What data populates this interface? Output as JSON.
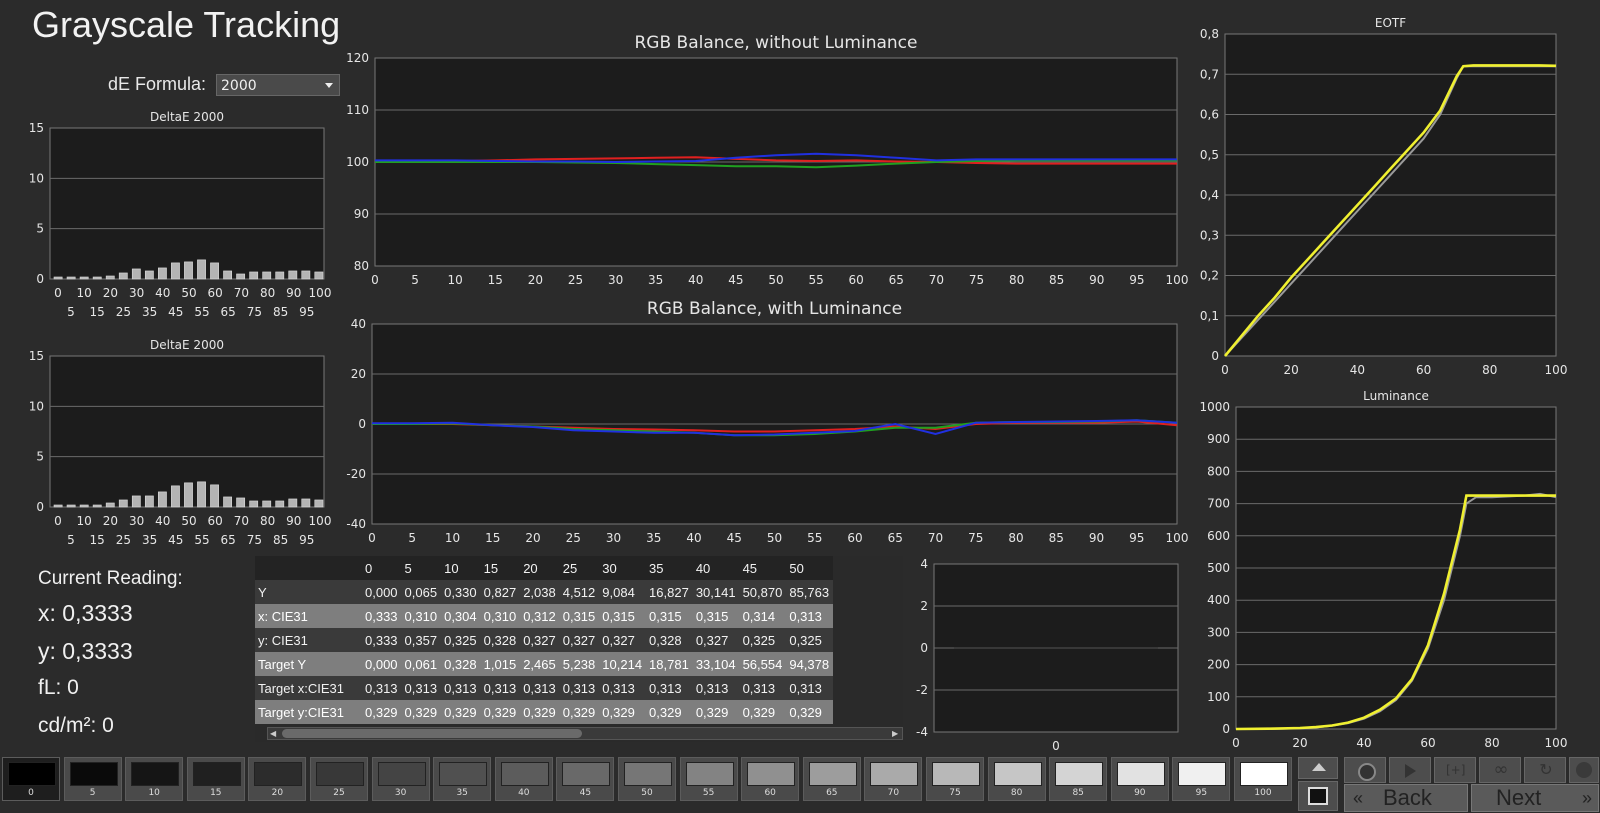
{
  "title": "Grayscale Tracking",
  "de_formula": {
    "label": "dE Formula:",
    "value": "2000"
  },
  "current_reading": {
    "heading": "Current Reading:",
    "x": "x: 0,3333",
    "y": "y: 0,3333",
    "fl": "fL: 0",
    "cdm2": "cd/m²: 0"
  },
  "chart_data": [
    {
      "id": "deltae1",
      "type": "bar",
      "title": "DeltaE 2000",
      "categories": [
        "0",
        "5",
        "10",
        "15",
        "20",
        "25",
        "30",
        "35",
        "40",
        "45",
        "50",
        "55",
        "60",
        "65",
        "70",
        "75",
        "80",
        "85",
        "90",
        "95",
        "100"
      ],
      "values": [
        0.2,
        0.2,
        0.2,
        0.2,
        0.3,
        0.6,
        1.0,
        0.8,
        1.1,
        1.6,
        1.7,
        1.9,
        1.6,
        0.8,
        0.5,
        0.7,
        0.7,
        0.7,
        0.8,
        0.8,
        0.7
      ],
      "ylim": [
        0,
        15
      ],
      "yticks": [
        "0",
        "5",
        "10",
        "15"
      ],
      "xticks_top": [
        "0",
        "10",
        "20",
        "30",
        "40",
        "50",
        "60",
        "70",
        "80",
        "90",
        "100"
      ],
      "xticks_bottom": [
        "5",
        "15",
        "25",
        "35",
        "45",
        "55",
        "65",
        "75",
        "85",
        "95"
      ]
    },
    {
      "id": "deltae2",
      "type": "bar",
      "title": "DeltaE 2000",
      "categories": [
        "0",
        "5",
        "10",
        "15",
        "20",
        "25",
        "30",
        "35",
        "40",
        "45",
        "50",
        "55",
        "60",
        "65",
        "70",
        "75",
        "80",
        "85",
        "90",
        "95",
        "100"
      ],
      "values": [
        0.2,
        0.2,
        0.2,
        0.2,
        0.4,
        0.7,
        1.1,
        1.1,
        1.5,
        2.1,
        2.4,
        2.5,
        2.2,
        1.0,
        0.9,
        0.6,
        0.6,
        0.6,
        0.8,
        0.8,
        0.7
      ],
      "ylim": [
        0,
        15
      ],
      "yticks": [
        "0",
        "5",
        "10",
        "15"
      ],
      "xticks_top": [
        "0",
        "10",
        "20",
        "30",
        "40",
        "50",
        "60",
        "70",
        "80",
        "90",
        "100"
      ],
      "xticks_bottom": [
        "5",
        "15",
        "25",
        "35",
        "45",
        "55",
        "65",
        "75",
        "85",
        "95"
      ]
    },
    {
      "id": "rgb_no_lum",
      "type": "line",
      "title": "RGB Balance, without Luminance",
      "x": [
        0,
        5,
        10,
        15,
        20,
        25,
        30,
        35,
        40,
        45,
        50,
        55,
        60,
        65,
        70,
        75,
        80,
        85,
        90,
        95,
        100
      ],
      "series": [
        {
          "color": "#e02020",
          "values": [
            100,
            100,
            100.2,
            100.3,
            100.5,
            100.6,
            100.7,
            100.8,
            100.9,
            100.6,
            100.3,
            100.2,
            100.3,
            100.1,
            100,
            99.8,
            99.7,
            99.7,
            99.7,
            99.7,
            99.7
          ]
        },
        {
          "color": "#20a020",
          "values": [
            100,
            100,
            100,
            100,
            100,
            99.9,
            99.8,
            99.6,
            99.4,
            99.2,
            99.2,
            99.0,
            99.3,
            99.7,
            100,
            100.2,
            100.3,
            100.3,
            100.3,
            100.3,
            100.3
          ]
        },
        {
          "color": "#2030e0",
          "values": [
            100.3,
            100.3,
            100.3,
            100.2,
            100.1,
            100.1,
            100.0,
            100.1,
            100.2,
            100.8,
            101.3,
            101.6,
            101.3,
            100.8,
            100.3,
            100.5,
            100.5,
            100.5,
            100.5,
            100.5,
            100.5
          ]
        }
      ],
      "ylim": [
        80,
        120
      ],
      "yticks": [
        "80",
        "90",
        "100",
        "110",
        "120"
      ],
      "xticks": [
        "0",
        "5",
        "10",
        "15",
        "20",
        "25",
        "30",
        "35",
        "40",
        "45",
        "50",
        "55",
        "60",
        "65",
        "70",
        "75",
        "80",
        "85",
        "90",
        "95",
        "100"
      ]
    },
    {
      "id": "rgb_lum",
      "type": "line",
      "title": "RGB Balance, with Luminance",
      "x": [
        0,
        5,
        10,
        15,
        20,
        25,
        30,
        35,
        40,
        45,
        50,
        55,
        60,
        65,
        70,
        75,
        80,
        85,
        90,
        95,
        100
      ],
      "series": [
        {
          "color": "#e02020",
          "values": [
            0,
            0,
            0,
            -0.5,
            -1,
            -1.5,
            -2,
            -2.2,
            -2.5,
            -3,
            -3,
            -2.5,
            -2,
            -1,
            -2,
            0,
            0.5,
            0.5,
            0.5,
            1,
            -0.5
          ]
        },
        {
          "color": "#20a020",
          "values": [
            0,
            0,
            0.2,
            -0.5,
            -1,
            -2,
            -2.5,
            -3,
            -3.5,
            -4.5,
            -4.5,
            -4,
            -3,
            -1.5,
            -1.5,
            0.5,
            0.8,
            0.8,
            1,
            1.5,
            0.5
          ]
        },
        {
          "color": "#2030e0",
          "values": [
            0.3,
            0.3,
            0.5,
            -0.5,
            -1.2,
            -2.5,
            -3,
            -3.5,
            -3.5,
            -4.5,
            -4.2,
            -3.5,
            -2.8,
            0,
            -4,
            0.5,
            0.8,
            1,
            1.2,
            1.5,
            0.5
          ]
        }
      ],
      "ylim": [
        -40,
        40
      ],
      "yticks": [
        "-40",
        "-20",
        "0",
        "20",
        "40"
      ],
      "xticks": [
        "0",
        "5",
        "10",
        "15",
        "20",
        "25",
        "30",
        "35",
        "40",
        "45",
        "50",
        "55",
        "60",
        "65",
        "70",
        "75",
        "80",
        "85",
        "90",
        "95",
        "100"
      ]
    },
    {
      "id": "eotf",
      "type": "line",
      "title": "EOTF",
      "x": [
        0,
        5,
        10,
        15,
        20,
        25,
        30,
        35,
        40,
        45,
        50,
        55,
        60,
        65,
        70,
        72,
        75,
        80,
        85,
        90,
        95,
        100
      ],
      "series": [
        {
          "color": "#9a9a9a",
          "values": [
            0,
            0.045,
            0.09,
            0.135,
            0.18,
            0.225,
            0.27,
            0.315,
            0.36,
            0.405,
            0.45,
            0.495,
            0.54,
            0.6,
            0.69,
            0.72,
            0.72,
            0.72,
            0.72,
            0.72,
            0.72,
            0.72
          ]
        },
        {
          "color": "#f0f030",
          "values": [
            0,
            0.05,
            0.1,
            0.145,
            0.195,
            0.24,
            0.285,
            0.33,
            0.375,
            0.42,
            0.465,
            0.51,
            0.555,
            0.61,
            0.695,
            0.72,
            0.722,
            0.722,
            0.722,
            0.722,
            0.722,
            0.721
          ]
        }
      ],
      "ylim": [
        0,
        0.8
      ],
      "yticks": [
        "0",
        "0,1",
        "0,2",
        "0,3",
        "0,4",
        "0,5",
        "0,6",
        "0,7",
        "0,8"
      ],
      "xlim": [
        0,
        100
      ],
      "xticks": [
        "0",
        "20",
        "40",
        "60",
        "80",
        "100"
      ]
    },
    {
      "id": "luminance",
      "type": "line",
      "title": "Luminance",
      "x": [
        0,
        10,
        20,
        25,
        30,
        35,
        40,
        45,
        50,
        55,
        60,
        65,
        70,
        72,
        75,
        80,
        90,
        95,
        100
      ],
      "series": [
        {
          "color": "#9a9a9a",
          "values": [
            0,
            0,
            2,
            5,
            10,
            18,
            32,
            55,
            90,
            150,
            250,
            400,
            600,
            700,
            720,
            720,
            725,
            730,
            720
          ]
        },
        {
          "color": "#f0f030",
          "values": [
            0,
            1,
            3,
            6,
            11,
            20,
            35,
            60,
            95,
            155,
            260,
            420,
            620,
            725,
            725,
            725,
            725,
            725,
            725
          ]
        }
      ],
      "ylim": [
        0,
        1000
      ],
      "yticks": [
        "0",
        "100",
        "200",
        "300",
        "400",
        "500",
        "600",
        "700",
        "800",
        "900",
        "1000"
      ],
      "xlim": [
        0,
        100
      ],
      "xticks": [
        "0",
        "20",
        "40",
        "60",
        "80",
        "100"
      ]
    },
    {
      "id": "small",
      "type": "line",
      "title": "",
      "x": [
        0,
        1
      ],
      "series": [
        {
          "color": "#555555",
          "values": [
            0,
            0
          ]
        }
      ],
      "ylim": [
        -4,
        4
      ],
      "yticks": [
        "-4",
        "-2",
        "0",
        "2",
        "4"
      ],
      "xticks": [
        "0"
      ]
    }
  ],
  "table": {
    "columns": [
      "",
      "0",
      "5",
      "10",
      "15",
      "20",
      "25",
      "30",
      "35",
      "40",
      "45",
      "50"
    ],
    "rows": [
      [
        "Y",
        "0,000",
        "0,065",
        "0,330",
        "0,827",
        "2,038",
        "4,512",
        "9,084",
        "16,827",
        "30,141",
        "50,870",
        "85,763"
      ],
      [
        "x: CIE31",
        "0,333",
        "0,310",
        "0,304",
        "0,310",
        "0,312",
        "0,315",
        "0,315",
        "0,315",
        "0,315",
        "0,314",
        "0,313"
      ],
      [
        "y: CIE31",
        "0,333",
        "0,357",
        "0,325",
        "0,328",
        "0,327",
        "0,327",
        "0,327",
        "0,328",
        "0,327",
        "0,325",
        "0,325"
      ],
      [
        "Target Y",
        "0,000",
        "0,061",
        "0,328",
        "1,015",
        "2,465",
        "5,238",
        "10,214",
        "18,781",
        "33,104",
        "56,554",
        "94,378"
      ],
      [
        "Target x:CIE31",
        "0,313",
        "0,313",
        "0,313",
        "0,313",
        "0,313",
        "0,313",
        "0,313",
        "0,313",
        "0,313",
        "0,313",
        "0,313"
      ],
      [
        "Target y:CIE31",
        "0,329",
        "0,329",
        "0,329",
        "0,329",
        "0,329",
        "0,329",
        "0,329",
        "0,329",
        "0,329",
        "0,329",
        "0,329"
      ]
    ]
  },
  "swatches": [
    {
      "label": "0",
      "color": "#000000"
    },
    {
      "label": "5",
      "color": "#0a0a0a"
    },
    {
      "label": "10",
      "color": "#151515"
    },
    {
      "label": "15",
      "color": "#202020"
    },
    {
      "label": "20",
      "color": "#2c2c2c"
    },
    {
      "label": "25",
      "color": "#383838"
    },
    {
      "label": "30",
      "color": "#444444"
    },
    {
      "label": "35",
      "color": "#505050"
    },
    {
      "label": "40",
      "color": "#5c5c5c"
    },
    {
      "label": "45",
      "color": "#696969"
    },
    {
      "label": "50",
      "color": "#767676"
    },
    {
      "label": "55",
      "color": "#838383"
    },
    {
      "label": "60",
      "color": "#909090"
    },
    {
      "label": "65",
      "color": "#9d9d9d"
    },
    {
      "label": "70",
      "color": "#aaaaaa"
    },
    {
      "label": "75",
      "color": "#b8b8b8"
    },
    {
      "label": "80",
      "color": "#c6c6c6"
    },
    {
      "label": "85",
      "color": "#d4d4d4"
    },
    {
      "label": "90",
      "color": "#e2e2e2"
    },
    {
      "label": "95",
      "color": "#f0f0f0"
    },
    {
      "label": "100",
      "color": "#ffffff"
    }
  ],
  "nav": {
    "back": "Back",
    "next": "Next"
  },
  "icons": {
    "up": "chevron-up-icon",
    "stop": "stop-icon",
    "play": "play-icon",
    "continuous": "infinity-icon",
    "refresh": "refresh-icon"
  }
}
